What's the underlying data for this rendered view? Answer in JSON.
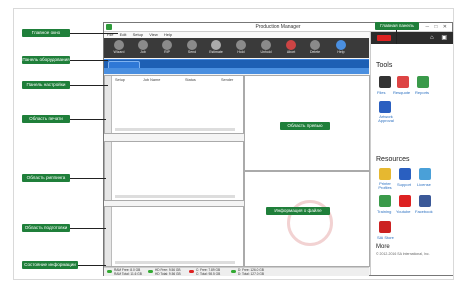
{
  "window": {
    "title": "Production Manager",
    "menu": [
      "File",
      "Edit",
      "Setup",
      "View",
      "Help"
    ]
  },
  "toolbar": {
    "buttons": [
      "Wizard",
      "Job",
      "RIP",
      "Send",
      "Estimate",
      "Hold",
      "Unhold",
      "Abort",
      "Delete",
      "Help"
    ]
  },
  "queue": {
    "columns": [
      "Setup",
      "Job Name",
      "Status",
      "Sender"
    ]
  },
  "statusbar": {
    "items": [
      "RAM Free: 8.0 GB",
      "RAM Total: 11.6 GB",
      "HD Free: 9.56 GB",
      "HD Total: 9.56 GB",
      "C: Free: 7.89 GB",
      "C: Total: 98.5 GB",
      "D: Free: 126.0 GB",
      "D: Total: 127.0 GB"
    ]
  },
  "panel": {
    "tools_title": "Tools",
    "tools": [
      "Files",
      "Resquote",
      "Reports",
      "Artwork Approval"
    ],
    "resources_title": "Resources",
    "resources": [
      "Printer Profiles",
      "Support",
      "License",
      "Training",
      "Youtube",
      "Facebook",
      "SAi Store"
    ],
    "more": "More",
    "copyright": "© 2012-2016 SA International, Inc."
  },
  "callouts": {
    "main_window": "Главное окно",
    "toolbar": "Панель оборудования",
    "settings_bar": "Панель настройки",
    "print_area": "Область печати",
    "rip_area": "Область риппинга",
    "prep_area": "Область подготовки",
    "status_info": "Состояние информации",
    "preview_area": "Область превью",
    "file_info": "Информация о файле",
    "main_panel": "Главная панель"
  },
  "colors": {
    "callout": "#1f7f3a",
    "toolbar": "#3a3a3a",
    "settings_bar": "#1d5fb4"
  }
}
